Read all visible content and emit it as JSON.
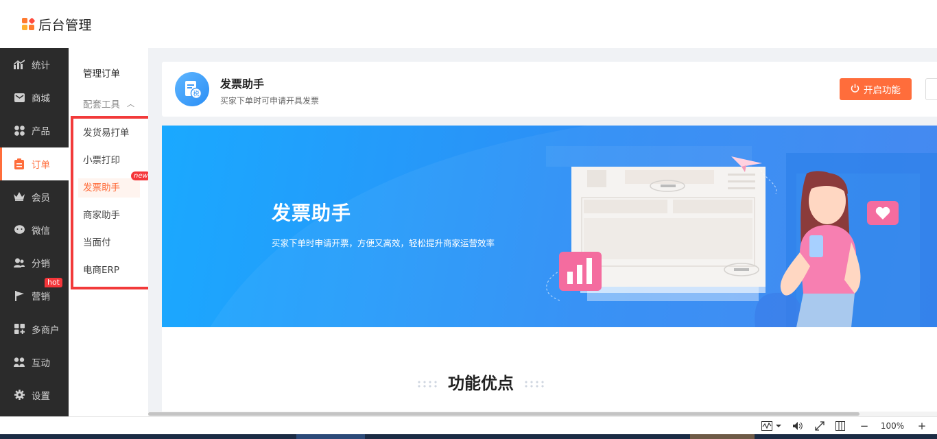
{
  "header": {
    "app_title": "后台管理"
  },
  "sidebar": {
    "items": [
      {
        "label": "统计",
        "icon": "chart-icon"
      },
      {
        "label": "商城",
        "icon": "mail-icon"
      },
      {
        "label": "产品",
        "icon": "grid-icon"
      },
      {
        "label": "订单",
        "icon": "clipboard-icon",
        "active": true
      },
      {
        "label": "会员",
        "icon": "crown-icon"
      },
      {
        "label": "微信",
        "icon": "chat-icon"
      },
      {
        "label": "分销",
        "icon": "users-icon"
      },
      {
        "label": "营销",
        "icon": "flag-icon",
        "badge": "hot"
      },
      {
        "label": "多商户",
        "icon": "store-icon"
      },
      {
        "label": "互动",
        "icon": "interact-icon"
      },
      {
        "label": "设置",
        "icon": "gear-icon"
      }
    ]
  },
  "submenu": {
    "title": "管理订单",
    "group_label": "配套工具",
    "items": [
      {
        "label": "发货易打单"
      },
      {
        "label": "小票打印"
      },
      {
        "label": "发票助手",
        "active": true,
        "badge": "new"
      },
      {
        "label": "商家助手"
      },
      {
        "label": "当面付"
      },
      {
        "label": "电商ERP"
      }
    ]
  },
  "plugin": {
    "title": "发票助手",
    "description": "买家下单时可申请开具发票",
    "icon_char": "税",
    "open_button": "开启功能"
  },
  "banner": {
    "title": "发票助手",
    "subtitle": "买家下单时申请开票，方便又高效，轻松提升商家运营效率"
  },
  "advantages": {
    "title": "功能优点"
  },
  "statusbar": {
    "zoom": "100%"
  },
  "colors": {
    "accent": "#ff6d3b",
    "sidebar_bg": "#2b2b2b",
    "banner_start": "#1aa9ff",
    "banner_end": "#3c82f0",
    "badge_red": "#f5363a"
  }
}
